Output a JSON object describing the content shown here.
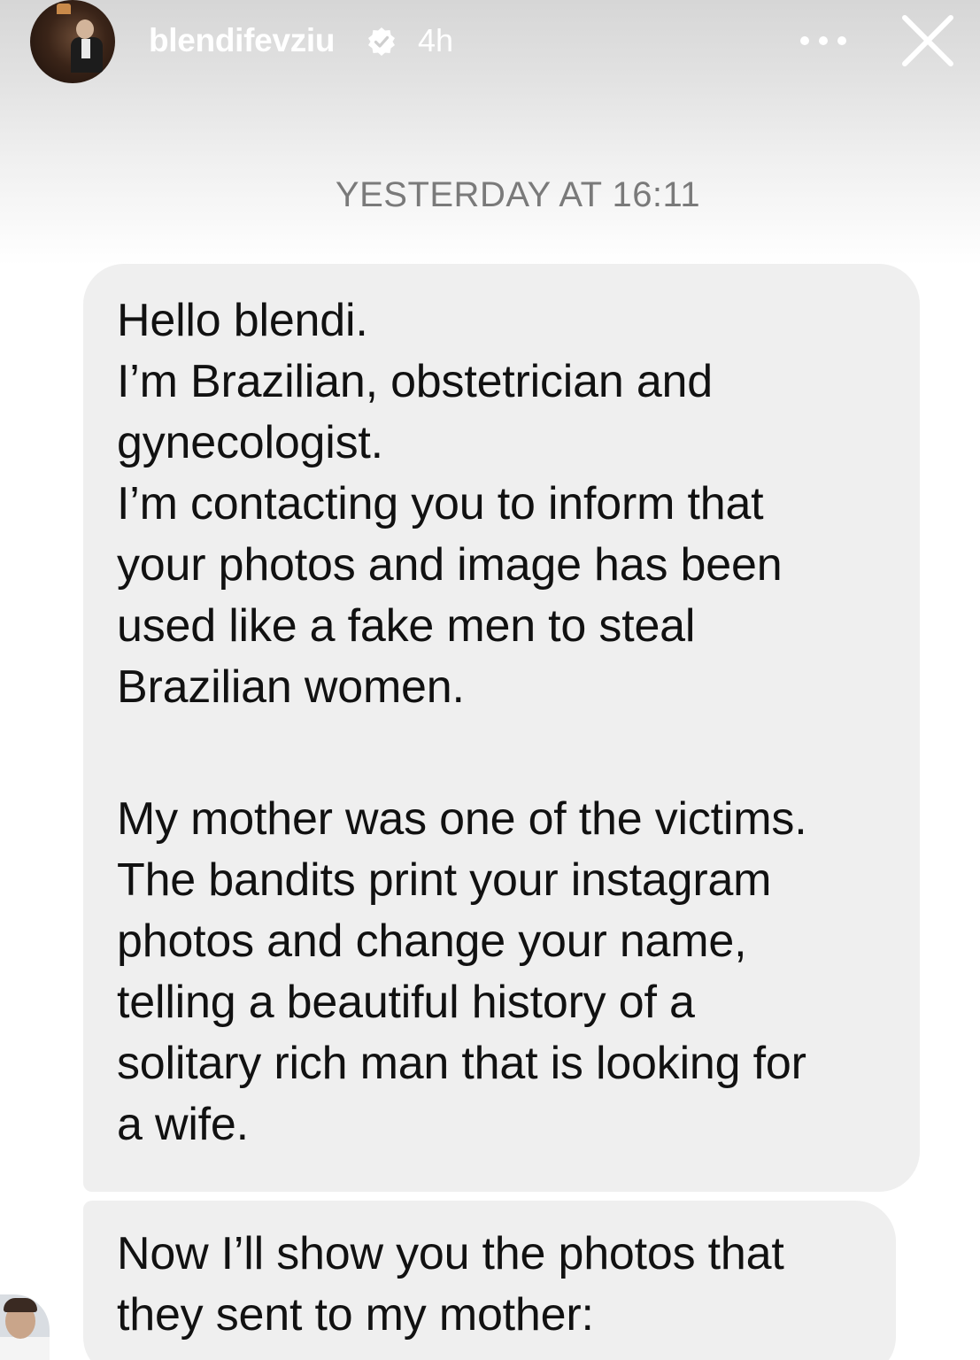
{
  "story": {
    "username": "blendifevziu",
    "time_ago": "4h",
    "verified": true
  },
  "conversation": {
    "timestamp": "YESTERDAY AT 16:11",
    "message1": {
      "lines": [
        "Hello blendi.",
        "I’m Brazilian, obstetrician and",
        "gynecologist.",
        "I’m contacting you to inform that",
        "your photos and image has been",
        "used like a fake men to steal",
        "Brazilian women."
      ],
      "lines2": [
        "My mother was one of the victims.",
        "The bandits print your instagram",
        "photos and change your name,",
        "telling a beautiful history of a",
        "solitary rich man that is looking for",
        "a wife."
      ]
    },
    "message2": {
      "lines": [
        "Now I’ll show you the photos that",
        "they sent to my mother:"
      ]
    }
  },
  "icons": {
    "more": "more-horizontal-icon",
    "close": "close-icon",
    "verified": "verified-badge-icon"
  }
}
